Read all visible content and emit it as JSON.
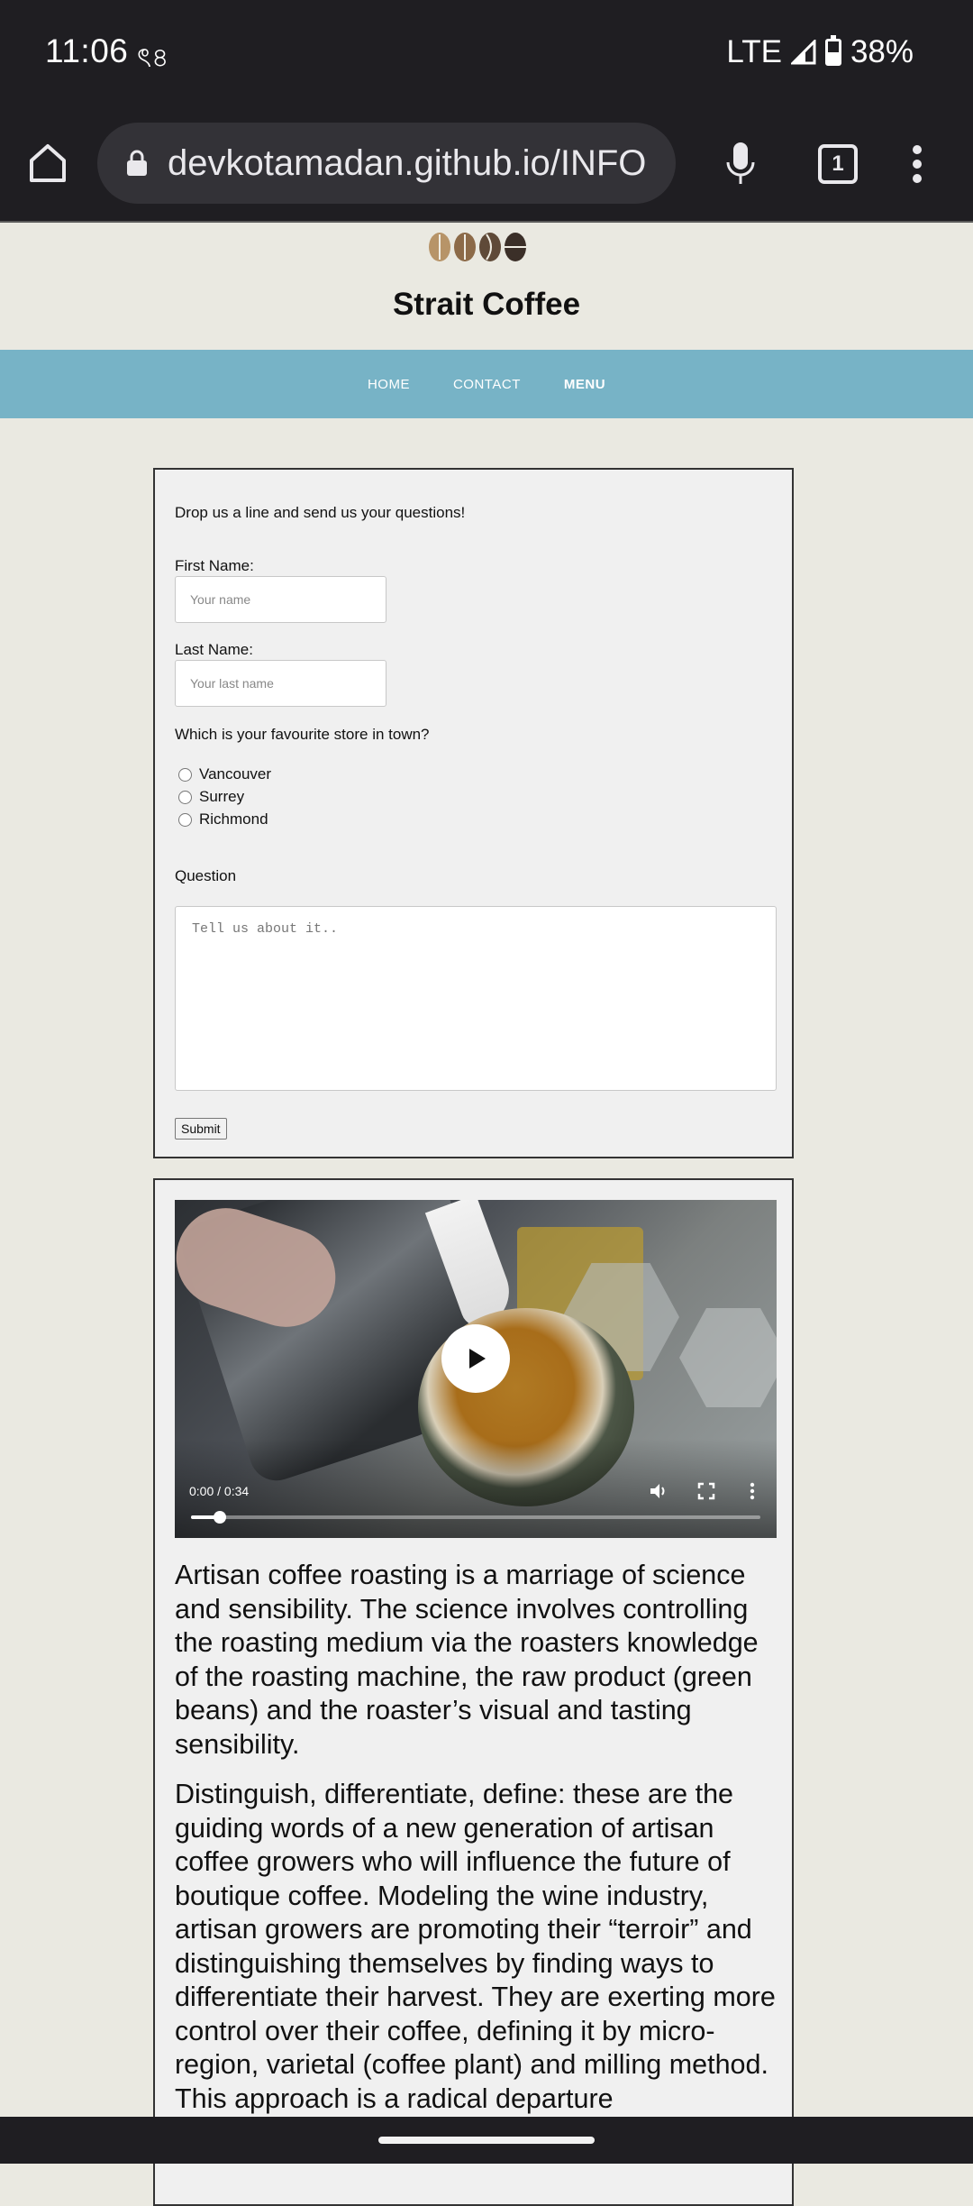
{
  "status_bar": {
    "time": "11:06",
    "extra": "ৎ৪",
    "network": "LTE",
    "battery": "38%"
  },
  "browser": {
    "url": "devkotamadan.github.io/INFO",
    "tab_count": "1"
  },
  "site": {
    "title": "Strait Coffee"
  },
  "nav": {
    "items": [
      {
        "label": "HOME"
      },
      {
        "label": "CONTACT"
      },
      {
        "label": "MENU"
      }
    ],
    "active": "MENU"
  },
  "form": {
    "intro": "Drop us a line and send us your questions!",
    "first_name_label": "First Name:",
    "first_name_placeholder": "Your name",
    "last_name_label": "Last Name:",
    "last_name_placeholder": "Your last name",
    "store_question": "Which is your favourite store in town?",
    "stores": [
      "Vancouver",
      "Surrey",
      "Richmond"
    ],
    "question_label": "Question",
    "question_placeholder": "Tell us about it..",
    "submit_label": "Submit"
  },
  "video": {
    "time": "0:00 / 0:34",
    "progress": 0.05
  },
  "article": {
    "p1": "Artisan coffee roasting is a marriage of science and sensibility. The science involves controlling the roasting medium via the roasters knowledge of the roasting machine, the raw product (green beans) and the roaster’s visual and tasting sensibility.",
    "p2": "Distinguish, differentiate, define: these are the guiding words of a new generation of artisan coffee growers who will influence the future of boutique coffee. Modeling the wine industry, artisan growers are promoting their “terroir” and distinguishing themselves by finding ways to differentiate their harvest. They are exerting more control over their coffee, defining it by micro-region, varietal (coffee plant) and milling method. This approach is a radical departure"
  }
}
